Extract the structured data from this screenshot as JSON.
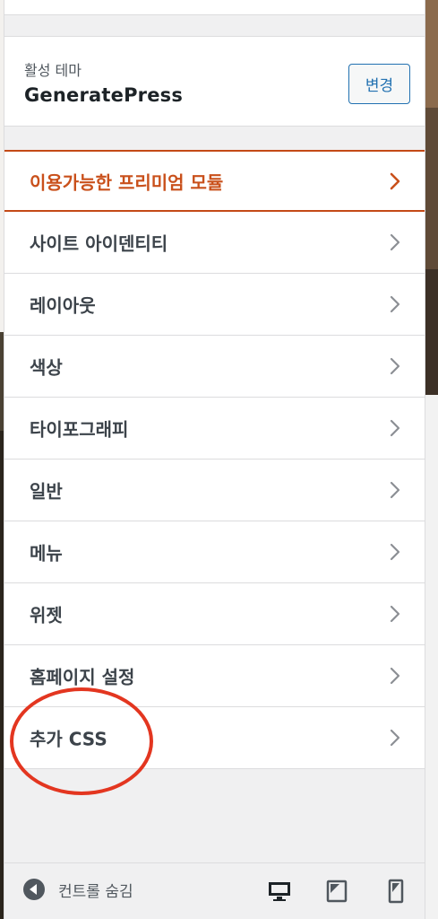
{
  "theme": {
    "label": "활성 테마",
    "name": "GeneratePress",
    "change_label": "변경"
  },
  "menu": {
    "items": [
      {
        "label": "이용가능한 프리미엄 모듈",
        "highlight": true
      },
      {
        "label": "사이트 아이덴티티"
      },
      {
        "label": "레이아웃"
      },
      {
        "label": "색상"
      },
      {
        "label": "타이포그래피"
      },
      {
        "label": "일반"
      },
      {
        "label": "메뉴"
      },
      {
        "label": "위젯"
      },
      {
        "label": "홈페이지 설정"
      },
      {
        "label": "추가 CSS"
      }
    ]
  },
  "footer": {
    "hide_controls_label": "컨트롤 숨김",
    "devices": [
      "desktop-icon",
      "tablet-icon",
      "mobile-icon"
    ]
  },
  "colors": {
    "accent": "#2271b1",
    "premium": "#c9501b",
    "annotation_circle": "#e33620"
  }
}
